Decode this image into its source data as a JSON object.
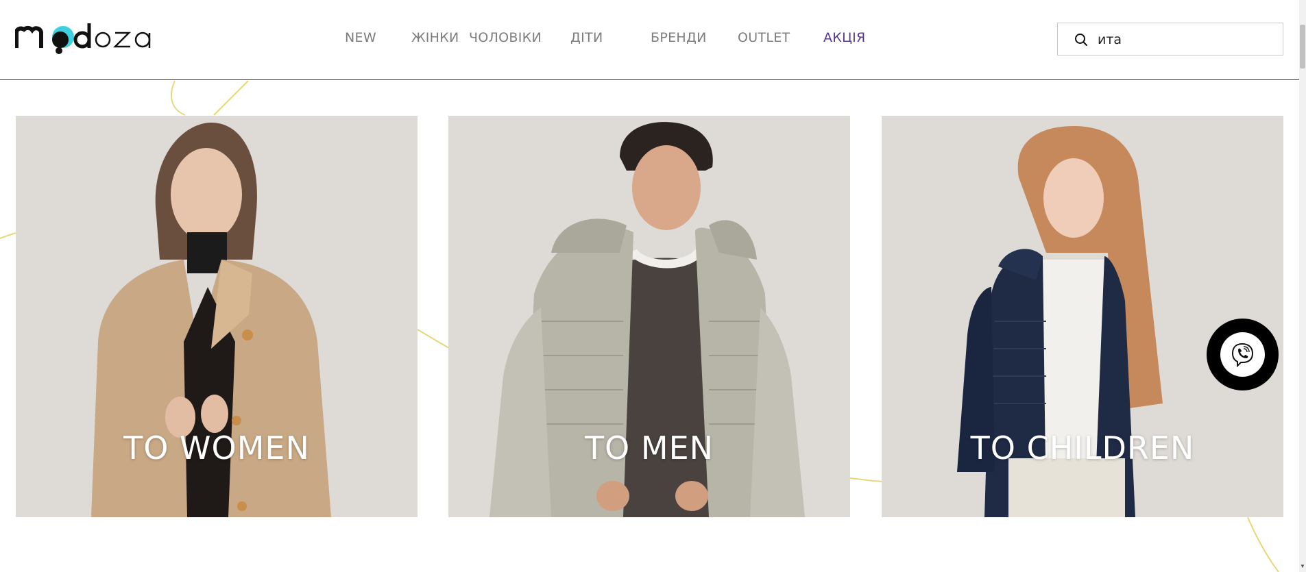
{
  "header": {
    "logo_text": "modoza",
    "nav": [
      {
        "label": "NEW"
      },
      {
        "label": "ЖІНКИ"
      },
      {
        "label": "ЧОЛОВІКИ"
      },
      {
        "label": "ДІТИ"
      },
      {
        "label": "БРЕНДИ"
      },
      {
        "label": "OUTLET"
      },
      {
        "label": "АКЦІЯ"
      }
    ],
    "search": {
      "value": "ита",
      "icon": "search-icon"
    }
  },
  "categories": [
    {
      "label": "TO WOMEN"
    },
    {
      "label": "TO MEN"
    },
    {
      "label": "TO CHILDREN"
    }
  ],
  "floating": {
    "icon": "viber-icon"
  },
  "colors": {
    "accent_sale": "#5a3a8c",
    "nav_text": "#7d7d7d",
    "decor_lines": "#e8d77a",
    "logo_accent": "#3fd0e0"
  }
}
